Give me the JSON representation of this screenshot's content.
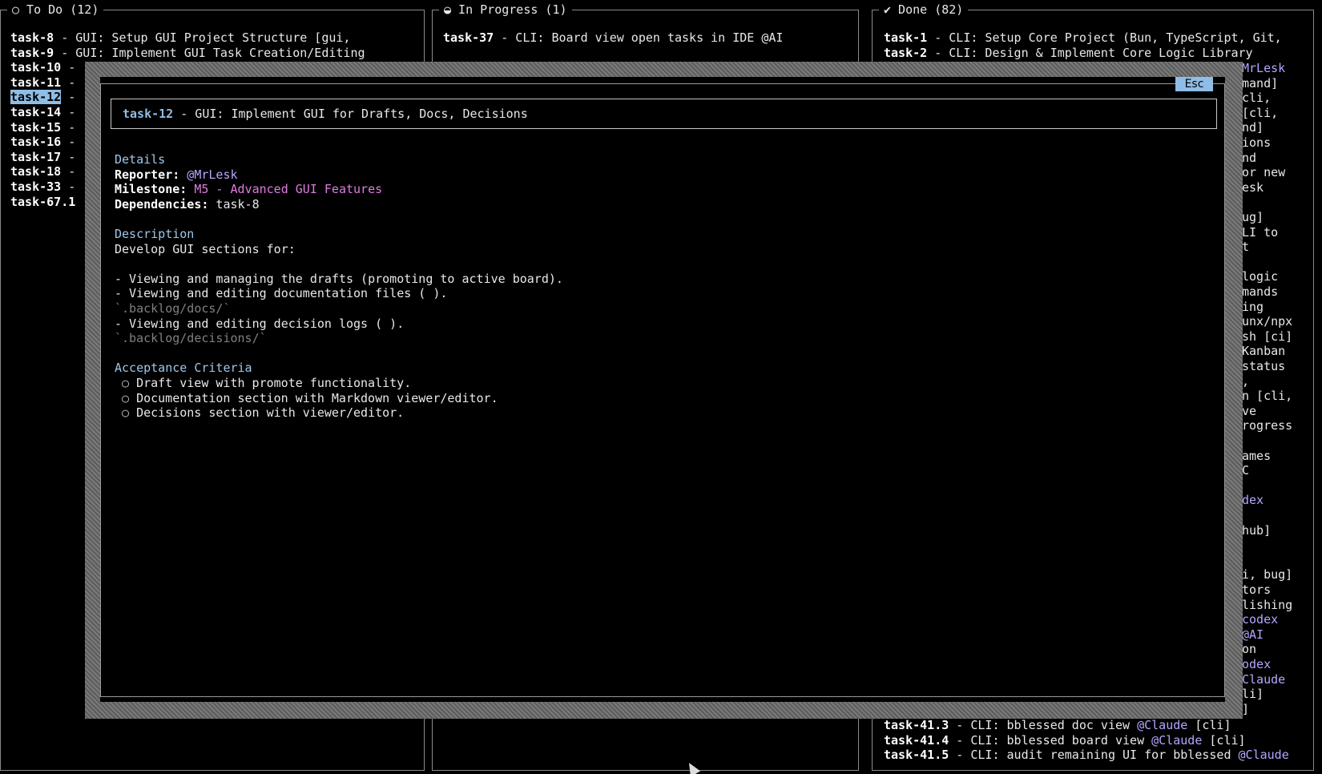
{
  "columns": {
    "todo": {
      "title": "○ To Do (12)",
      "rows": [
        {
          "id": "task-8",
          "text": " - GUI: Setup GUI Project Structure [gui,"
        },
        {
          "id": "task-9",
          "text": " - GUI: Implement GUI Task Creation/Editing"
        },
        {
          "id": "task-10",
          "text": " -"
        },
        {
          "id": "task-11",
          "text": " -"
        },
        {
          "id": "task-12",
          "text": " -"
        },
        {
          "id": "task-14",
          "text": " -"
        },
        {
          "id": "task-15",
          "text": " -"
        },
        {
          "id": "task-16",
          "text": " -"
        },
        {
          "id": "task-17",
          "text": " -"
        },
        {
          "id": "task-18",
          "text": " -"
        },
        {
          "id": "task-33",
          "text": " -"
        },
        {
          "id": "task-67.1",
          "text": ""
        }
      ]
    },
    "progress": {
      "title": "◒ In Progress (1)",
      "rows": [
        {
          "id": "task-37",
          "text": " - CLI: Board view open tasks in IDE @AI"
        }
      ]
    },
    "done": {
      "title": "✔ Done (82)",
      "rows_top": [
        {
          "id": "task-1",
          "text": " - CLI: Setup Core Project (Bun, TypeScript, Git,"
        },
        {
          "id": "task-2",
          "text": " - CLI: Design & Implement Core Logic Library"
        }
      ],
      "fragments": [
        "MrLesk",
        "mand]",
        "cli,",
        " [cli,",
        "nd]",
        "ions",
        "nd",
        "or new",
        "esk",
        "",
        "ug]",
        "LI to",
        "t",
        "",
        " logic",
        "mands",
        "ing",
        "unx/npx",
        "sh [ci]",
        "Kanban",
        "status",
        ",",
        "n [cli,",
        "ve",
        "rogress",
        "",
        "ames",
        "C",
        "",
        "dex",
        "",
        "hub]",
        "",
        "",
        "i, bug]",
        "tors",
        "lishing",
        "codex",
        " @AI",
        " on",
        "odex",
        "Claude",
        "li]",
        "]"
      ],
      "rows_bottom": [
        {
          "id": "task-41.3",
          "text": " - CLI: bblessed doc view ",
          "mention": "@Claude",
          "tail": " [cli]"
        },
        {
          "id": "task-41.4",
          "text": " - CLI: bblessed board view ",
          "mention": "@Claude",
          "tail": " [cli]"
        },
        {
          "id": "task-41.5",
          "text": " - CLI: audit remaining UI for bblessed ",
          "mention": "@Claude",
          "tail": ""
        }
      ]
    }
  },
  "modal": {
    "esc_label": "Esc",
    "task_id": "task-12",
    "task_title": " - GUI: Implement GUI for Drafts, Docs, Decisions",
    "details_heading": "Details",
    "reporter_label": "Reporter:",
    "reporter_value": " @MrLesk",
    "milestone_label": "Milestone:",
    "milestone_value": " M5 - Advanced GUI Features",
    "dependencies_label": "Dependencies:",
    "dependencies_value": " task-8",
    "description_heading": "Description",
    "description_lines": [
      {
        "text": "Develop GUI sections for:",
        "dim": false
      },
      {
        "text": "",
        "dim": false
      },
      {
        "text": "- Viewing and managing the drafts (promoting to active board).",
        "dim": false
      },
      {
        "text": "- Viewing and editing documentation files ( ).",
        "dim": false
      },
      {
        "text": "`.backlog/docs/`",
        "dim": true
      },
      {
        "text": "- Viewing and editing decision logs ( ).",
        "dim": false
      },
      {
        "text": "`.backlog/decisions/`",
        "dim": true
      }
    ],
    "acceptance_heading": "Acceptance Criteria",
    "criteria": [
      "Draft view with promote functionality.",
      "Documentation section with Markdown viewer/editor.",
      "Decisions section with viewer/editor."
    ],
    "criteria_bullet": "○"
  }
}
